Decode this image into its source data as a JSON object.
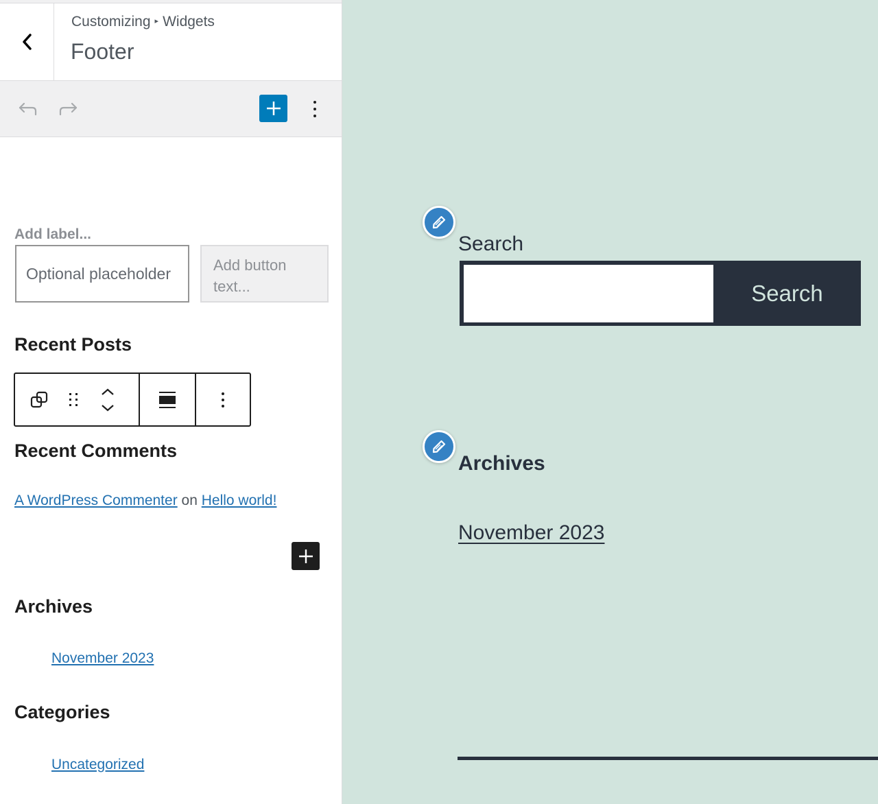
{
  "sidebar": {
    "breadcrumb": {
      "parent": "Customizing",
      "separator": "▸",
      "current": "Widgets"
    },
    "title": "Footer",
    "toolbar": {
      "undo_icon": "undo-icon",
      "redo_icon": "redo-icon",
      "add_block_icon": "plus-icon",
      "options_icon": "more-vertical-icon",
      "accent_color": "#007cba"
    },
    "search_block": {
      "label_placeholder": "Add label...",
      "input_placeholder": "Optional placeholder",
      "button_placeholder": "Add button text..."
    },
    "headings": {
      "recent_posts": "Recent Posts",
      "recent_comments": "Recent Comments",
      "archives": "Archives",
      "categories": "Categories"
    },
    "block_toolbar": {
      "buttons": [
        "duplicate-icon",
        "drag-handle-icon",
        "move-up-icon",
        "move-down-icon",
        "align-icon",
        "more-vertical-icon"
      ]
    },
    "recent_comment": {
      "author": "A WordPress Commenter",
      "connector": "on",
      "post": "Hello world!"
    },
    "archive_link": "November 2023",
    "category_link": "Uncategorized",
    "link_color": "#2271b1"
  },
  "preview": {
    "background_color": "#d1e4dd",
    "search_label": "Search",
    "search_input_value": "",
    "search_button": "Search",
    "archives_heading": "Archives",
    "archive_link": "November 2023",
    "edit_icon": "pencil-icon"
  }
}
